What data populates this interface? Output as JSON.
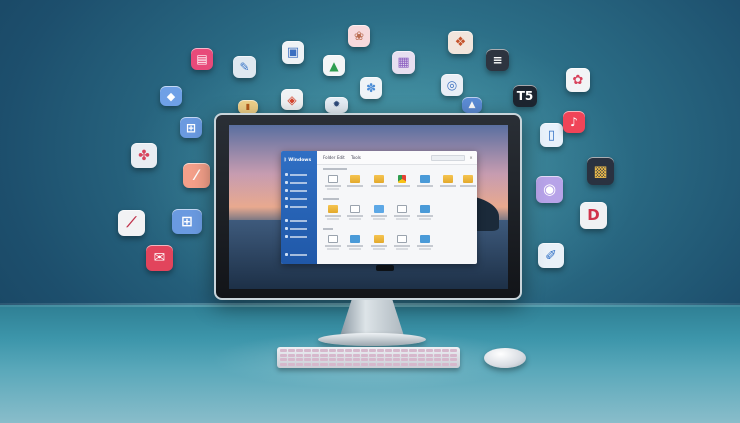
{
  "scene": {
    "subject": "desktop-computer-with-floating-app-icons"
  },
  "screen_window": {
    "brand": "ᛒ Windows",
    "tabs": [
      "Folder",
      "Edit",
      "Tools"
    ],
    "sections": [
      "",
      "",
      ""
    ]
  },
  "apps": [
    {
      "name": "office-icon",
      "bg": "#e84a7a",
      "fg": "#ffffff",
      "glyph": "▤"
    },
    {
      "name": "document-edit-icon",
      "bg": "#dfe8f0",
      "fg": "#3a76c8",
      "glyph": "✎"
    },
    {
      "name": "news-icon",
      "bg": "#eef2f5",
      "fg": "#3b6fc0",
      "glyph": "▣"
    },
    {
      "name": "gallery-icon",
      "bg": "#f7d9dc",
      "fg": "#b86a4e",
      "glyph": "❀"
    },
    {
      "name": "drive-icon",
      "bg": "#f4f5f6",
      "fg": "#2f9d4f",
      "glyph": "▲"
    },
    {
      "name": "notes-icon",
      "bg": "#e7dff0",
      "fg": "#8a5cc0",
      "glyph": "▦"
    },
    {
      "name": "photo-icon",
      "bg": "#f2e5dc",
      "fg": "#c6542c",
      "glyph": "❖"
    },
    {
      "name": "text-app-icon",
      "bg": "#2d3440",
      "fg": "#ffffff",
      "glyph": "≡"
    },
    {
      "name": "cube-icon",
      "bg": "#6fa0e6",
      "fg": "#ffffff",
      "glyph": "◆"
    },
    {
      "name": "chart-icon",
      "bg": "#f1d28a",
      "fg": "#b65a1b",
      "glyph": "▮"
    },
    {
      "name": "vector-icon",
      "bg": "#f0f2f4",
      "fg": "#d7442c",
      "glyph": "◈"
    },
    {
      "name": "settings-icon",
      "bg": "#e6eef6",
      "fg": "#2e4a7a",
      "glyph": "✹"
    },
    {
      "name": "mountain-icon",
      "bg": "#5c8cd6",
      "fg": "#ffffff",
      "glyph": "▲"
    },
    {
      "name": "target-icon",
      "bg": "#e9eef5",
      "fg": "#3a6fc0",
      "glyph": "◎"
    },
    {
      "name": "flower-icon",
      "bg": "#eef3f7",
      "fg": "#4a8cd6",
      "glyph": "✽"
    },
    {
      "name": "ts-icon",
      "bg": "#1d2530",
      "fg": "#ffffff",
      "glyph": "T5"
    },
    {
      "name": "petal-icon",
      "bg": "#f2f4f6",
      "fg": "#d8425c",
      "glyph": "✿"
    },
    {
      "name": "file-icon",
      "bg": "#e8f1fb",
      "fg": "#2f6fc4",
      "glyph": "▯"
    },
    {
      "name": "music-icon",
      "bg": "#f04458",
      "fg": "#ffffff",
      "glyph": "♪"
    },
    {
      "name": "gift-icon",
      "bg": "#e9edf2",
      "fg": "#d8425c",
      "glyph": "✤"
    },
    {
      "name": "pencil-icon",
      "bg": "#f4a08a",
      "fg": "#ffffff",
      "glyph": "⁄"
    },
    {
      "name": "grid-app-icon",
      "bg": "#2a3240",
      "fg": "#f2c04c",
      "glyph": "▩"
    },
    {
      "name": "brush-icon",
      "bg": "#f2f2f4",
      "fg": "#c0334c",
      "glyph": "⟋"
    },
    {
      "name": "widgets-icon",
      "bg": "#6a9ae0",
      "fg": "#ffffff",
      "glyph": "⊞"
    },
    {
      "name": "sphere-icon",
      "bg": "#b7a3e8",
      "fg": "#ffffff",
      "glyph": "◉"
    },
    {
      "name": "letter-d-icon",
      "bg": "#f0f1f3",
      "fg": "#d0324a",
      "glyph": "D"
    },
    {
      "name": "chat-icon",
      "bg": "#e2445c",
      "fg": "#ffffff",
      "glyph": "✉"
    },
    {
      "name": "draw-icon",
      "bg": "#e9f1f8",
      "fg": "#2f6fc4",
      "glyph": "✐"
    }
  ]
}
